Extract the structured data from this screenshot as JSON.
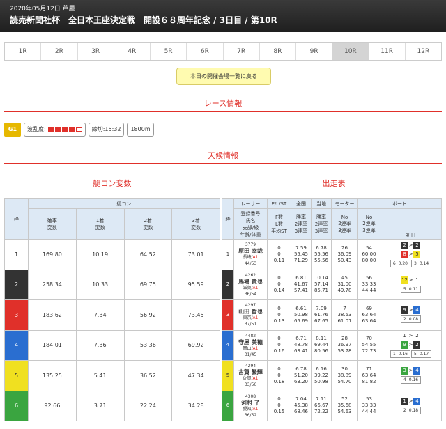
{
  "header": {
    "date": "2020年05月12日 芦屋",
    "title": "読売新聞社杯　全日本王座決定戦　開設６８周年記念 / 3日目 / 第10R"
  },
  "tabs": [
    "1R",
    "2R",
    "3R",
    "4R",
    "5R",
    "6R",
    "7R",
    "8R",
    "9R",
    "10R",
    "11R",
    "12R"
  ],
  "active_tab": "10R",
  "back_button": "本日の開催会場一覧に戻る",
  "sections": {
    "race_info": "レース情報",
    "weather": "天候情報",
    "boat_con": "艇コン変数",
    "entry": "出走表"
  },
  "race": {
    "grade": "G1",
    "wave_label": "波乱度:",
    "wave_level": 4,
    "wave_max": 5,
    "deadline": "締切:15:32",
    "distance": "1800m"
  },
  "left_table": {
    "col_waku": "枠",
    "group": "艇コン",
    "cols": [
      "確率\n変数",
      "1着\n変数",
      "2着\n変数",
      "3着\n変数"
    ],
    "rows": [
      [
        "1",
        "169.80",
        "10.19",
        "64.52",
        "73.01"
      ],
      [
        "2",
        "258.34",
        "10.33",
        "69.75",
        "95.59"
      ],
      [
        "3",
        "183.62",
        "7.34",
        "56.92",
        "73.45"
      ],
      [
        "4",
        "184.01",
        "7.36",
        "53.36",
        "69.92"
      ],
      [
        "5",
        "135.25",
        "5.41",
        "36.52",
        "47.34"
      ],
      [
        "6",
        "92.66",
        "3.71",
        "22.24",
        "34.28"
      ]
    ]
  },
  "right_table": {
    "head": [
      "枠",
      "レーサー",
      "F/L/ST",
      "全国",
      "当地",
      "モーター",
      "ボート"
    ],
    "sub": [
      "登録番号\n氏名\n支部/級\n年齢/体重",
      "F数\nL数\n平均ST",
      "勝率\n2連率\n3連率",
      "勝率\n2連率\n3連率",
      "No\n2連率\n3連率",
      "No\n2連率\n3連率",
      "初日"
    ],
    "rows": [
      {
        "w": "1",
        "reg": "3779",
        "name": "原田 幸哉",
        "branch": "長崎/",
        "cls": "A1",
        "age": "44/53",
        "fl": [
          "0",
          "0",
          "0.11"
        ],
        "nat": [
          "7.59",
          "55.45",
          "71.29"
        ],
        "loc": [
          "6.78",
          "55.56",
          "55.56"
        ],
        "mot": [
          "26",
          "36.09",
          "50.43"
        ],
        "boat": [
          "54",
          "60.00",
          "80.00"
        ],
        "sh": [
          [
            "2",
            "w2"
          ],
          [
            "2",
            "w2"
          ],
          [
            "8",
            "w3"
          ],
          [
            "5",
            "w5"
          ]
        ],
        "st": [
          [
            "6",
            "0.20"
          ],
          [
            "3",
            "0.14"
          ]
        ]
      },
      {
        "w": "2",
        "reg": "4262",
        "name": "馬場 貴也",
        "branch": "滋賀/",
        "cls": "A1",
        "age": "36/54",
        "fl": [
          "0",
          "0",
          "0.14"
        ],
        "nat": [
          "6.81",
          "41.67",
          "57.41"
        ],
        "loc": [
          "10.14",
          "57.14",
          "85.71"
        ],
        "mot": [
          "45",
          "31.00",
          "49.78"
        ],
        "boat": [
          "56",
          "33.33",
          "44.44"
        ],
        "sh": [
          [
            "12",
            "w5"
          ],
          [
            "1",
            "w1"
          ]
        ],
        "st": [
          [
            "5",
            "0.11"
          ]
        ]
      },
      {
        "w": "3",
        "reg": "4297",
        "name": "山田 哲也",
        "branch": "東京/",
        "cls": "A1",
        "age": "37/51",
        "fl": [
          "0",
          "0",
          "0.13"
        ],
        "nat": [
          "6.61",
          "50.98",
          "65.69"
        ],
        "loc": [
          "7.09",
          "61.76",
          "67.65"
        ],
        "mot": [
          "7",
          "38.53",
          "61.01"
        ],
        "boat": [
          "69",
          "63.64",
          "63.64"
        ],
        "sh": [
          [
            "9",
            "w2"
          ],
          [
            "4",
            "w4"
          ]
        ],
        "st": [
          [
            "2",
            "0.08"
          ]
        ]
      },
      {
        "w": "4",
        "reg": "4482",
        "name": "守屋 美穂",
        "branch": "岡山/",
        "cls": "A1",
        "age": "31/45",
        "fl": [
          "0",
          "0",
          "0.16"
        ],
        "nat": [
          "6.71",
          "48.78",
          "63.41"
        ],
        "loc": [
          "8.11",
          "69.44",
          "80.56"
        ],
        "mot": [
          "28",
          "36.97",
          "53.78"
        ],
        "boat": [
          "70",
          "54.55",
          "72.73"
        ],
        "sh": [
          [
            "1",
            "w1"
          ],
          [
            "2",
            "w1"
          ],
          [
            "9",
            "w6"
          ],
          [
            "2",
            "w2"
          ]
        ],
        "st": [
          [
            "1",
            "0.16"
          ],
          [
            "5",
            "0.17"
          ]
        ]
      },
      {
        "w": "5",
        "reg": "4294",
        "name": "古賀 繁輝",
        "branch": "佐賀/",
        "cls": "A1",
        "age": "33/56",
        "fl": [
          "0",
          "0",
          "0.18"
        ],
        "nat": [
          "6.78",
          "51.20",
          "63.20"
        ],
        "loc": [
          "6.16",
          "39.22",
          "50.98"
        ],
        "mot": [
          "30",
          "38.89",
          "54.70"
        ],
        "boat": [
          "71",
          "63.64",
          "81.82"
        ],
        "sh": [
          [
            "3",
            "w6"
          ],
          [
            "4",
            "w4"
          ]
        ],
        "st": [
          [
            "4",
            "0.16"
          ]
        ]
      },
      {
        "w": "6",
        "reg": "4308",
        "name": "河村 了",
        "branch": "愛知/",
        "cls": "A1",
        "age": "36/52",
        "fl": [
          "0",
          "0",
          "0.15"
        ],
        "nat": [
          "7.04",
          "45.38",
          "68.46"
        ],
        "loc": [
          "7.11",
          "66.67",
          "72.22"
        ],
        "mot": [
          "52",
          "35.68",
          "54.63"
        ],
        "boat": [
          "53",
          "33.33",
          "44.44"
        ],
        "sh": [
          [
            "1",
            "w2"
          ],
          [
            "4",
            "w4"
          ]
        ],
        "st": [
          [
            "2",
            "0.18"
          ]
        ]
      }
    ]
  },
  "colors": {
    "accent": "#e0302a",
    "header_bg": "#2a2a2a",
    "table_head": "#dde9f5",
    "button_bg": "#fffbb0"
  }
}
